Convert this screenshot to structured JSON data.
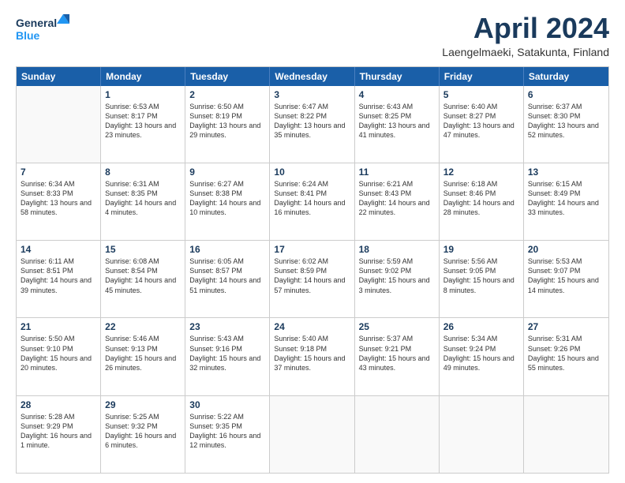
{
  "header": {
    "logo_line1": "General",
    "logo_line2": "Blue",
    "month_title": "April 2024",
    "location": "Laengelmaeki, Satakunta, Finland"
  },
  "days": [
    "Sunday",
    "Monday",
    "Tuesday",
    "Wednesday",
    "Thursday",
    "Friday",
    "Saturday"
  ],
  "weeks": [
    [
      {
        "day": "",
        "sunrise": "",
        "sunset": "",
        "daylight": ""
      },
      {
        "day": "1",
        "sunrise": "Sunrise: 6:53 AM",
        "sunset": "Sunset: 8:17 PM",
        "daylight": "Daylight: 13 hours and 23 minutes."
      },
      {
        "day": "2",
        "sunrise": "Sunrise: 6:50 AM",
        "sunset": "Sunset: 8:19 PM",
        "daylight": "Daylight: 13 hours and 29 minutes."
      },
      {
        "day": "3",
        "sunrise": "Sunrise: 6:47 AM",
        "sunset": "Sunset: 8:22 PM",
        "daylight": "Daylight: 13 hours and 35 minutes."
      },
      {
        "day": "4",
        "sunrise": "Sunrise: 6:43 AM",
        "sunset": "Sunset: 8:25 PM",
        "daylight": "Daylight: 13 hours and 41 minutes."
      },
      {
        "day": "5",
        "sunrise": "Sunrise: 6:40 AM",
        "sunset": "Sunset: 8:27 PM",
        "daylight": "Daylight: 13 hours and 47 minutes."
      },
      {
        "day": "6",
        "sunrise": "Sunrise: 6:37 AM",
        "sunset": "Sunset: 8:30 PM",
        "daylight": "Daylight: 13 hours and 52 minutes."
      }
    ],
    [
      {
        "day": "7",
        "sunrise": "Sunrise: 6:34 AM",
        "sunset": "Sunset: 8:33 PM",
        "daylight": "Daylight: 13 hours and 58 minutes."
      },
      {
        "day": "8",
        "sunrise": "Sunrise: 6:31 AM",
        "sunset": "Sunset: 8:35 PM",
        "daylight": "Daylight: 14 hours and 4 minutes."
      },
      {
        "day": "9",
        "sunrise": "Sunrise: 6:27 AM",
        "sunset": "Sunset: 8:38 PM",
        "daylight": "Daylight: 14 hours and 10 minutes."
      },
      {
        "day": "10",
        "sunrise": "Sunrise: 6:24 AM",
        "sunset": "Sunset: 8:41 PM",
        "daylight": "Daylight: 14 hours and 16 minutes."
      },
      {
        "day": "11",
        "sunrise": "Sunrise: 6:21 AM",
        "sunset": "Sunset: 8:43 PM",
        "daylight": "Daylight: 14 hours and 22 minutes."
      },
      {
        "day": "12",
        "sunrise": "Sunrise: 6:18 AM",
        "sunset": "Sunset: 8:46 PM",
        "daylight": "Daylight: 14 hours and 28 minutes."
      },
      {
        "day": "13",
        "sunrise": "Sunrise: 6:15 AM",
        "sunset": "Sunset: 8:49 PM",
        "daylight": "Daylight: 14 hours and 33 minutes."
      }
    ],
    [
      {
        "day": "14",
        "sunrise": "Sunrise: 6:11 AM",
        "sunset": "Sunset: 8:51 PM",
        "daylight": "Daylight: 14 hours and 39 minutes."
      },
      {
        "day": "15",
        "sunrise": "Sunrise: 6:08 AM",
        "sunset": "Sunset: 8:54 PM",
        "daylight": "Daylight: 14 hours and 45 minutes."
      },
      {
        "day": "16",
        "sunrise": "Sunrise: 6:05 AM",
        "sunset": "Sunset: 8:57 PM",
        "daylight": "Daylight: 14 hours and 51 minutes."
      },
      {
        "day": "17",
        "sunrise": "Sunrise: 6:02 AM",
        "sunset": "Sunset: 8:59 PM",
        "daylight": "Daylight: 14 hours and 57 minutes."
      },
      {
        "day": "18",
        "sunrise": "Sunrise: 5:59 AM",
        "sunset": "Sunset: 9:02 PM",
        "daylight": "Daylight: 15 hours and 3 minutes."
      },
      {
        "day": "19",
        "sunrise": "Sunrise: 5:56 AM",
        "sunset": "Sunset: 9:05 PM",
        "daylight": "Daylight: 15 hours and 8 minutes."
      },
      {
        "day": "20",
        "sunrise": "Sunrise: 5:53 AM",
        "sunset": "Sunset: 9:07 PM",
        "daylight": "Daylight: 15 hours and 14 minutes."
      }
    ],
    [
      {
        "day": "21",
        "sunrise": "Sunrise: 5:50 AM",
        "sunset": "Sunset: 9:10 PM",
        "daylight": "Daylight: 15 hours and 20 minutes."
      },
      {
        "day": "22",
        "sunrise": "Sunrise: 5:46 AM",
        "sunset": "Sunset: 9:13 PM",
        "daylight": "Daylight: 15 hours and 26 minutes."
      },
      {
        "day": "23",
        "sunrise": "Sunrise: 5:43 AM",
        "sunset": "Sunset: 9:16 PM",
        "daylight": "Daylight: 15 hours and 32 minutes."
      },
      {
        "day": "24",
        "sunrise": "Sunrise: 5:40 AM",
        "sunset": "Sunset: 9:18 PM",
        "daylight": "Daylight: 15 hours and 37 minutes."
      },
      {
        "day": "25",
        "sunrise": "Sunrise: 5:37 AM",
        "sunset": "Sunset: 9:21 PM",
        "daylight": "Daylight: 15 hours and 43 minutes."
      },
      {
        "day": "26",
        "sunrise": "Sunrise: 5:34 AM",
        "sunset": "Sunset: 9:24 PM",
        "daylight": "Daylight: 15 hours and 49 minutes."
      },
      {
        "day": "27",
        "sunrise": "Sunrise: 5:31 AM",
        "sunset": "Sunset: 9:26 PM",
        "daylight": "Daylight: 15 hours and 55 minutes."
      }
    ],
    [
      {
        "day": "28",
        "sunrise": "Sunrise: 5:28 AM",
        "sunset": "Sunset: 9:29 PM",
        "daylight": "Daylight: 16 hours and 1 minute."
      },
      {
        "day": "29",
        "sunrise": "Sunrise: 5:25 AM",
        "sunset": "Sunset: 9:32 PM",
        "daylight": "Daylight: 16 hours and 6 minutes."
      },
      {
        "day": "30",
        "sunrise": "Sunrise: 5:22 AM",
        "sunset": "Sunset: 9:35 PM",
        "daylight": "Daylight: 16 hours and 12 minutes."
      },
      {
        "day": "",
        "sunrise": "",
        "sunset": "",
        "daylight": ""
      },
      {
        "day": "",
        "sunrise": "",
        "sunset": "",
        "daylight": ""
      },
      {
        "day": "",
        "sunrise": "",
        "sunset": "",
        "daylight": ""
      },
      {
        "day": "",
        "sunrise": "",
        "sunset": "",
        "daylight": ""
      }
    ]
  ]
}
